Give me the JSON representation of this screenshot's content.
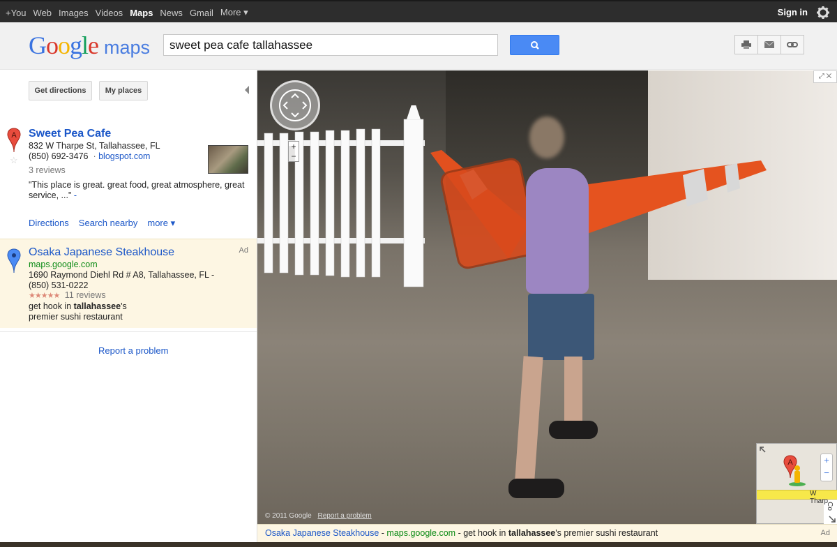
{
  "topnav": {
    "links": [
      "+You",
      "Web",
      "Images",
      "Videos",
      "Maps",
      "News",
      "Gmail",
      "More ▾"
    ],
    "active_index": 4,
    "signin_label": "Sign in",
    "settings_icon": "gear-icon"
  },
  "header": {
    "logo_google": "Google",
    "logo_maps": "maps",
    "search_value": "sweet pea cafe tallahassee",
    "search_icon": "search-icon",
    "tools": [
      "print-icon",
      "email-icon",
      "link-icon"
    ]
  },
  "sidebar": {
    "get_directions_label": "Get directions",
    "my_places_label": "My places",
    "result1": {
      "marker": "A",
      "title": "Sweet Pea Cafe",
      "address": "832 W Tharpe St, Tallahassee, FL",
      "phone": "(850) 692-3476",
      "separator": "·",
      "site": "blogspot.com",
      "reviews": "3 reviews",
      "quote": "\"This place is great. great food, great atmosphere, great",
      "quote2": "service, ...\"",
      "quote_dash": "-",
      "links": {
        "directions": "Directions",
        "search_nearby": "Search nearby",
        "more": "more ▾"
      }
    },
    "ad": {
      "label": "Ad",
      "title": "Osaka Japanese Steakhouse",
      "url": "maps.google.com",
      "address": "1690 Raymond Diehl Rd # A8, Tallahassee, FL -",
      "phone": "(850) 531-0222",
      "rating": 4.5,
      "stars": "★★★★★",
      "reviews": "11 reviews",
      "desc_pre": "get hook in ",
      "desc_bold": "tallahassee",
      "desc_post": "'s",
      "desc2": "premier sushi restaurant"
    },
    "report_problem": "Report a problem"
  },
  "streetview": {
    "copyright": "© 2011 Google",
    "report": "Report a problem",
    "fullscreen_icon": "fullscreen-icon",
    "zoom_in": "+",
    "zoom_out": "−",
    "minimap": {
      "road_label": "W Tharp",
      "side_label": "Co",
      "marker": "A",
      "zoom_in": "+",
      "zoom_out": "−"
    }
  },
  "bottom_ad": {
    "title": "Osaka Japanese Steakhouse",
    "sep1": " - ",
    "url": "maps.google.com",
    "sep2": " - get hook in ",
    "bold": "tallahassee",
    "post": "'s premier sushi restaurant",
    "label": "Ad"
  },
  "colors": {
    "link_blue": "#1a56c8",
    "search_blue": "#4a8af4",
    "ad_bg": "#fdf6e3",
    "marker_red": "#e84c3d",
    "marker_blue": "#4a8af4"
  }
}
